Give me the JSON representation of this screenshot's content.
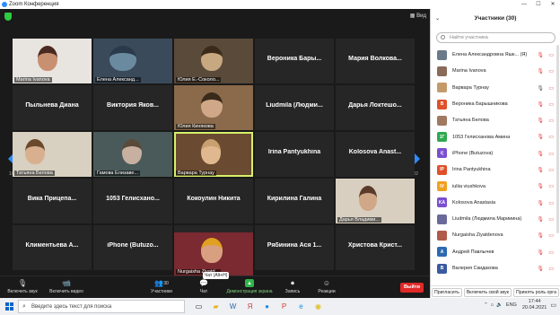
{
  "window": {
    "title": "Zoom Конференция"
  },
  "view_button": "Вид",
  "page_indicator": {
    "left": "1/2",
    "right": "2/2"
  },
  "tiles": [
    [
      {
        "type": "video",
        "label": "Marina Ivanova"
      },
      {
        "type": "video",
        "label": "Елена Александ..."
      },
      {
        "type": "video",
        "label": "Юлия Е.-Соколо..."
      },
      {
        "type": "name",
        "name": "Вероника Бары..."
      },
      {
        "type": "name",
        "name": "Мария Волкова..."
      }
    ],
    [
      {
        "type": "name",
        "name": "Пыльнева Диана"
      },
      {
        "type": "name",
        "name": "Виктория Яков..."
      },
      {
        "type": "video",
        "label": "Юлия Кинякова"
      },
      {
        "type": "name",
        "name": "Liudmila (Людми..."
      },
      {
        "type": "name",
        "name": "Дарья Локтешо..."
      }
    ],
    [
      {
        "type": "video",
        "label": "Татьяна Белова"
      },
      {
        "type": "video",
        "label": "Гамова Елизаве..."
      },
      {
        "type": "video",
        "label": "Варвара Турнау",
        "active": true
      },
      {
        "type": "name",
        "name": "Irina Pantyukhina"
      },
      {
        "type": "name",
        "name": "Kolosova Anast..."
      }
    ],
    [
      {
        "type": "name",
        "name": "Вика Прицепа..."
      },
      {
        "type": "name",
        "name": "1053 Гелисхано..."
      },
      {
        "type": "name",
        "name": "Кокоулин Никита"
      },
      {
        "type": "name",
        "name": "Кирилина Галина"
      },
      {
        "type": "video",
        "label": "Дарья Владими..."
      }
    ],
    [
      {
        "type": "name",
        "name": "Климентьева А..."
      },
      {
        "type": "name",
        "name": "iPhone (Butuzo..."
      },
      {
        "type": "name",
        "name": "Петрушенкова ..."
      },
      {
        "type": "name",
        "name": "Рябинина Ася 1..."
      },
      {
        "type": "name",
        "name": "Христова Крист..."
      }
    ]
  ],
  "extra_tile_label": "Nurgaisha Ziyatd...",
  "toolbar": {
    "mute": "Включить звук",
    "video": "Включить видео",
    "participants": "Участники",
    "participants_count": "30",
    "chat": "Чат",
    "chat_tooltip": "Чат (Alt+H)",
    "share": "Демонстрация экрана",
    "record": "Запись",
    "reactions": "Реакции",
    "leave": "Выйти"
  },
  "panel": {
    "title": "Участники (30)",
    "search_placeholder": "Найти участника",
    "participants": [
      {
        "name": "Елена Александровна Яшк... (Я)",
        "initials": "",
        "color": "#6b7a8a"
      },
      {
        "name": "Marina Ivanova",
        "initials": "",
        "color": "#8a6b5a"
      },
      {
        "name": "Варвара Турнау",
        "initials": "",
        "color": "#c49a6c"
      },
      {
        "name": "Вероника Барышникова",
        "initials": "В",
        "color": "#e0502a"
      },
      {
        "name": "Татьяна Белова",
        "initials": "",
        "color": "#a07a60"
      },
      {
        "name": "1053 Гелисханова Амина",
        "initials": "1Г",
        "color": "#2fa84f"
      },
      {
        "name": "iPhone (Butuzova)",
        "initials": "i(",
        "color": "#7b4fd0"
      },
      {
        "name": "Irina Pantyukhina",
        "initials": "IP",
        "color": "#e0502a"
      },
      {
        "name": "iuliia viushkova",
        "initials": "IV",
        "color": "#f0a020"
      },
      {
        "name": "Kolosova Anastasia",
        "initials": "KA",
        "color": "#7b4fd0"
      },
      {
        "name": "Liudmila (Людмила Марииина)",
        "initials": "",
        "color": "#6a6a9a"
      },
      {
        "name": "Nurgaisha Ziyatdenova",
        "initials": "",
        "color": "#b05a4a"
      },
      {
        "name": "Андрей Павлычев",
        "initials": "А",
        "color": "#2d6ab0"
      },
      {
        "name": "Валерия Скидакова",
        "initials": "В",
        "color": "#3a5aa0"
      }
    ],
    "footer": {
      "invite": "Пригласить",
      "mute_self": "Включить свой звук",
      "claim": "Принять роль орга"
    }
  },
  "taskbar": {
    "search_placeholder": "Введите здесь текст для поиска",
    "lang": "ENG",
    "time": "17:44",
    "date": "20.04.2021"
  }
}
